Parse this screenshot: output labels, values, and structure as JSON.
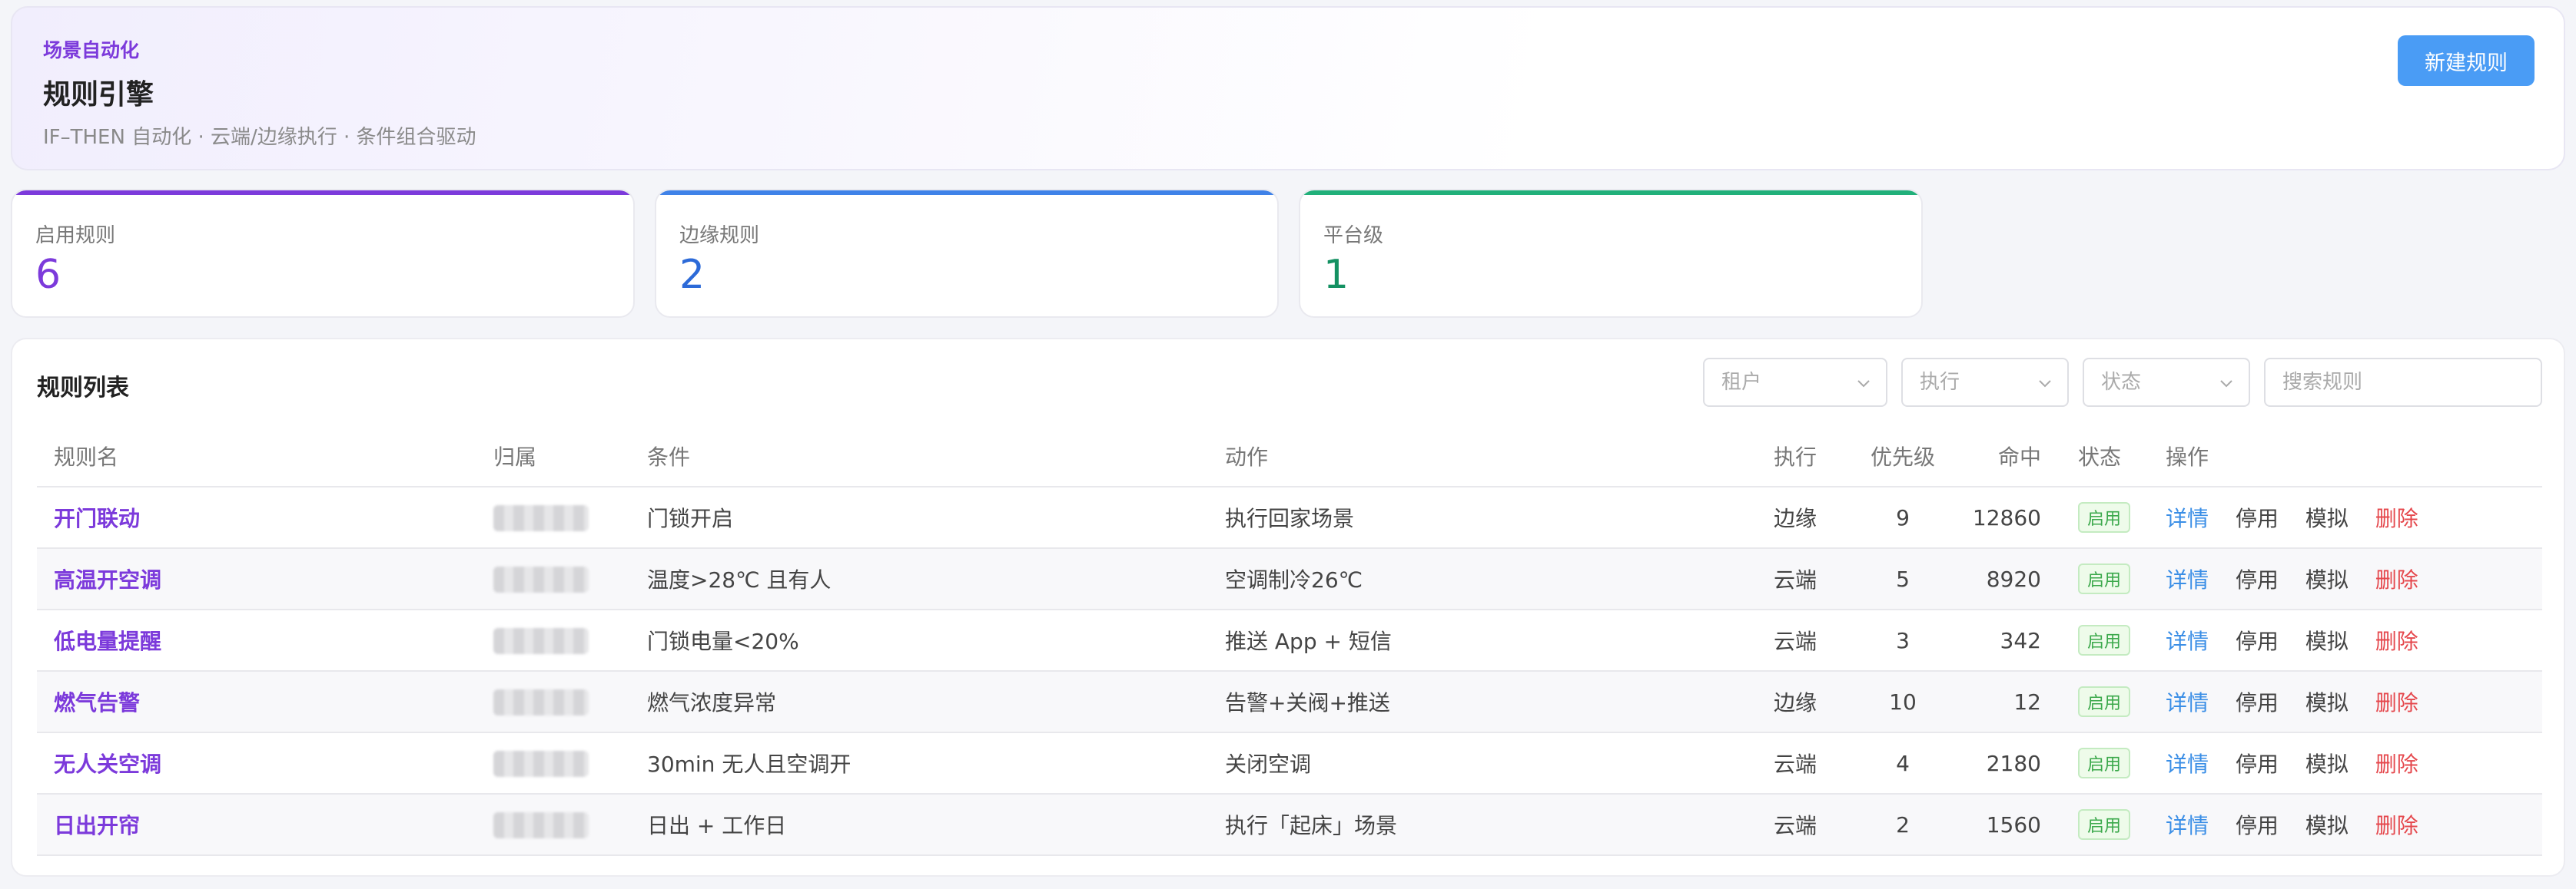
{
  "header": {
    "eyebrow": "场景自动化",
    "title": "规则引擎",
    "subtitle": "IF–THEN 自动化 · 云端/边缘执行 · 条件组合驱动",
    "new_rule_label": "新建规则"
  },
  "stats": [
    {
      "label": "启用规则",
      "value": "6"
    },
    {
      "label": "边缘规则",
      "value": "2"
    },
    {
      "label": "平台级",
      "value": "1"
    }
  ],
  "list": {
    "title": "规则列表",
    "filters": {
      "tenant": "租户",
      "exec": "执行",
      "status": "状态",
      "search_placeholder": "搜索规则"
    },
    "columns": [
      "规则名",
      "归属",
      "条件",
      "动作",
      "执行",
      "优先级",
      "命中",
      "状态",
      "操作"
    ],
    "rows": [
      {
        "name": "开门联动",
        "cond": "门锁开启",
        "action": "执行回家场景",
        "exec": "边缘",
        "priority": "9",
        "hits": "12860",
        "status": "启用"
      },
      {
        "name": "高温开空调",
        "cond": "温度>28℃ 且有人",
        "action": "空调制冷26℃",
        "exec": "云端",
        "priority": "5",
        "hits": "8920",
        "status": "启用"
      },
      {
        "name": "低电量提醒",
        "cond": "门锁电量<20%",
        "action": "推送 App + 短信",
        "exec": "云端",
        "priority": "3",
        "hits": "342",
        "status": "启用"
      },
      {
        "name": "燃气告警",
        "cond": "燃气浓度异常",
        "action": "告警+关阀+推送",
        "exec": "边缘",
        "priority": "10",
        "hits": "12",
        "status": "启用"
      },
      {
        "name": "无人关空调",
        "cond": "30min 无人且空调开",
        "action": "关闭空调",
        "exec": "云端",
        "priority": "4",
        "hits": "2180",
        "status": "启用"
      },
      {
        "name": "日出开帘",
        "cond": "日出 + 工作日",
        "action": "执行「起床」场景",
        "exec": "云端",
        "priority": "2",
        "hits": "1560",
        "status": "启用"
      }
    ],
    "ops": {
      "detail": "详情",
      "stop": "停用",
      "simulate": "模拟",
      "delete": "删除"
    }
  }
}
